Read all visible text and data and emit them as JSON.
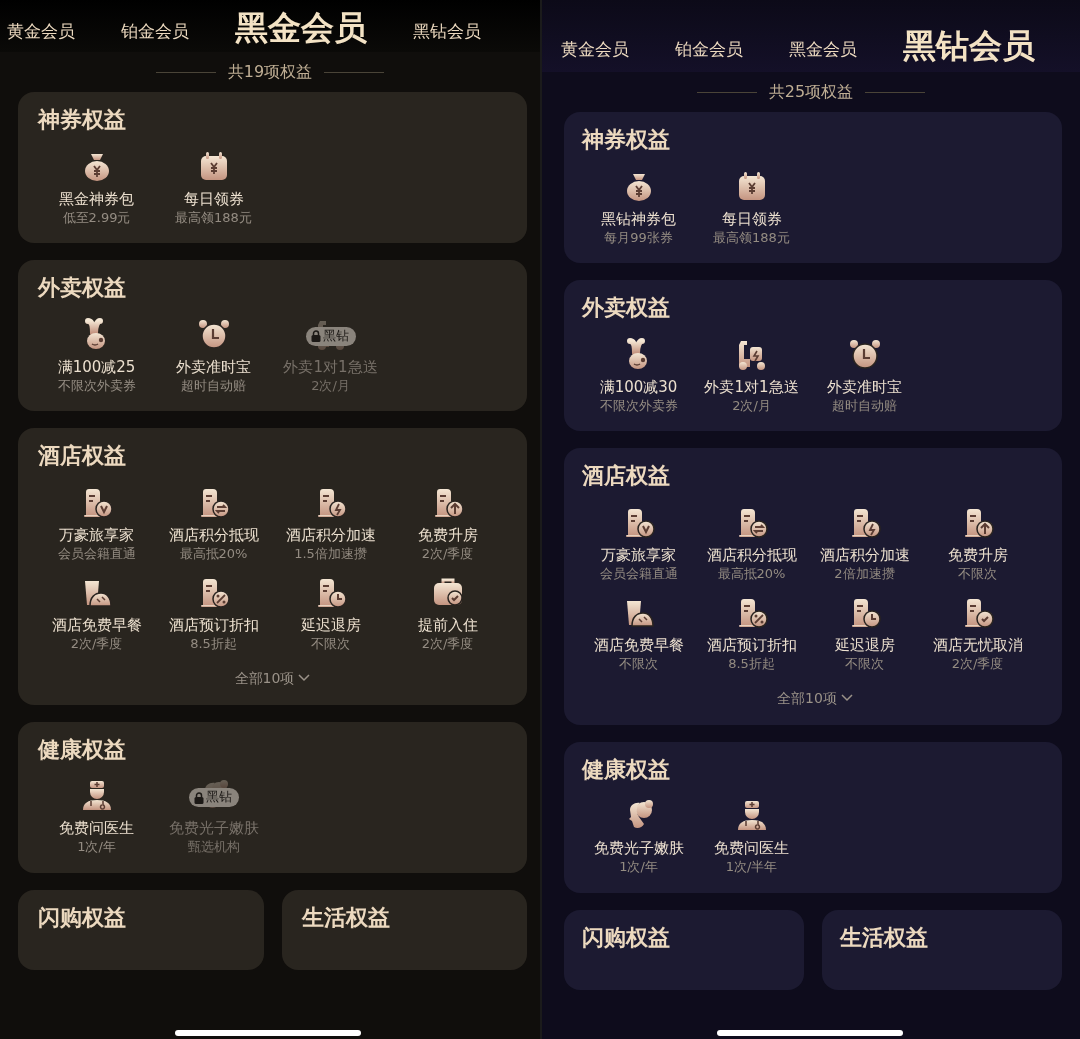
{
  "panels": [
    {
      "kind": "black-gold",
      "tabs": [
        {
          "label": "黄金会员",
          "selected": false
        },
        {
          "label": "铂金会员",
          "selected": false
        },
        {
          "label": "黑金会员",
          "selected": true
        },
        {
          "label": "黑钻会员",
          "selected": false
        }
      ],
      "total": "共19项权益",
      "sections": [
        {
          "title": "神券权益",
          "items": [
            {
              "kind": "moneybag",
              "name": "黑金神券包",
              "note": "低至2.99元",
              "locked": false
            },
            {
              "kind": "calendar",
              "name": "每日领券",
              "note": "最高领188元",
              "locked": false
            }
          ]
        },
        {
          "title": "外卖权益",
          "items": [
            {
              "kind": "rabbit",
              "name": "满100减25",
              "note": "不限次外卖券",
              "locked": false
            },
            {
              "kind": "alarm",
              "name": "外卖准时宝",
              "note": "超时自动赔",
              "locked": false
            },
            {
              "kind": "scooter",
              "name": "外卖1对1急送",
              "note": "2次/月",
              "locked": true,
              "lock_label": "黑钻"
            }
          ]
        },
        {
          "title": "酒店权益",
          "items": [
            {
              "kind": "hotel-v",
              "name": "万豪旅享家",
              "note": "会员会籍直通",
              "locked": false
            },
            {
              "kind": "hotel-swap",
              "name": "酒店积分抵现",
              "note": "最高抵20%",
              "locked": false
            },
            {
              "kind": "hotel-bolt",
              "name": "酒店积分加速",
              "note": "1.5倍加速攒",
              "locked": false
            },
            {
              "kind": "hotel-up",
              "name": "免费升房",
              "note": "2次/季度",
              "locked": false
            },
            {
              "kind": "bread",
              "name": "酒店免费早餐",
              "note": "2次/季度",
              "locked": false
            },
            {
              "kind": "hotel-percent",
              "name": "酒店预订折扣",
              "note": "8.5折起",
              "locked": false
            },
            {
              "kind": "hotel-clock",
              "name": "延迟退房",
              "note": "不限次",
              "locked": false
            },
            {
              "kind": "suitcase",
              "name": "提前入住",
              "note": "2次/季度",
              "locked": false
            }
          ],
          "more": "全部10项"
        },
        {
          "title": "健康权益",
          "items": [
            {
              "kind": "doctor",
              "name": "免费问医生",
              "note": "1次/年",
              "locked": false
            },
            {
              "kind": "face",
              "name": "免费光子嫩肤",
              "note": "甄选机构",
              "locked": true,
              "lock_label": "黑钻"
            }
          ]
        }
      ],
      "bottom_sections": [
        "闪购权益",
        "生活权益"
      ]
    },
    {
      "kind": "black-diamond",
      "tabs": [
        {
          "label": "黄金会员",
          "selected": false
        },
        {
          "label": "铂金会员",
          "selected": false
        },
        {
          "label": "黑金会员",
          "selected": false
        },
        {
          "label": "黑钻会员",
          "selected": true
        }
      ],
      "total": "共25项权益",
      "sections": [
        {
          "title": "神券权益",
          "items": [
            {
              "kind": "moneybag",
              "name": "黑钻神券包",
              "note": "每月99张券",
              "locked": false
            },
            {
              "kind": "calendar",
              "name": "每日领券",
              "note": "最高领188元",
              "locked": false
            }
          ]
        },
        {
          "title": "外卖权益",
          "items": [
            {
              "kind": "rabbit",
              "name": "满100减30",
              "note": "不限次外卖券",
              "locked": false
            },
            {
              "kind": "scooter",
              "name": "外卖1对1急送",
              "note": "2次/月",
              "locked": false
            },
            {
              "kind": "alarm",
              "name": "外卖准时宝",
              "note": "超时自动赔",
              "locked": false
            }
          ]
        },
        {
          "title": "酒店权益",
          "items": [
            {
              "kind": "hotel-v",
              "name": "万豪旅享家",
              "note": "会员会籍直通",
              "locked": false
            },
            {
              "kind": "hotel-swap",
              "name": "酒店积分抵现",
              "note": "最高抵20%",
              "locked": false
            },
            {
              "kind": "hotel-bolt",
              "name": "酒店积分加速",
              "note": "2倍加速攒",
              "locked": false
            },
            {
              "kind": "hotel-up",
              "name": "免费升房",
              "note": "不限次",
              "locked": false
            },
            {
              "kind": "bread",
              "name": "酒店免费早餐",
              "note": "不限次",
              "locked": false
            },
            {
              "kind": "hotel-percent",
              "name": "酒店预订折扣",
              "note": "8.5折起",
              "locked": false
            },
            {
              "kind": "hotel-clock",
              "name": "延迟退房",
              "note": "不限次",
              "locked": false
            },
            {
              "kind": "hotel-shield",
              "name": "酒店无忧取消",
              "note": "2次/季度",
              "locked": false
            }
          ],
          "more": "全部10项"
        },
        {
          "title": "健康权益",
          "items": [
            {
              "kind": "face",
              "name": "免费光子嫩肤",
              "note": "1次/年",
              "locked": false
            },
            {
              "kind": "doctor",
              "name": "免费问医生",
              "note": "1次/半年",
              "locked": false
            }
          ]
        }
      ],
      "bottom_sections": [
        "闪购权益",
        "生活权益"
      ]
    }
  ]
}
